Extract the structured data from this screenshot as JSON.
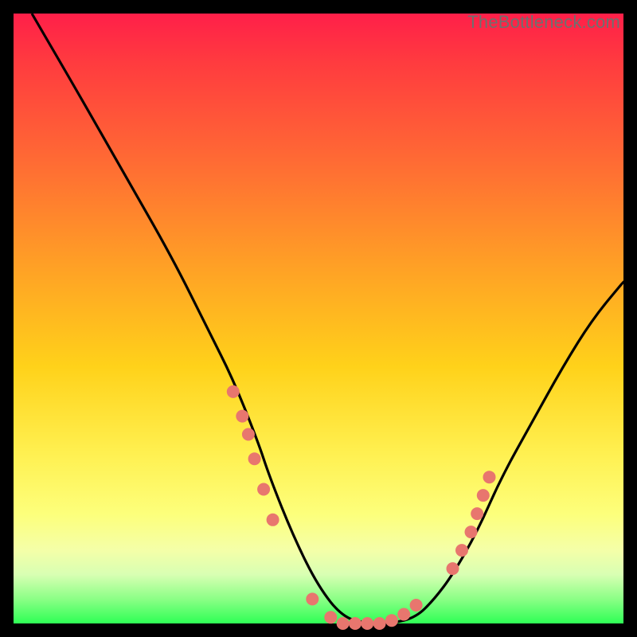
{
  "watermark": "TheBottleneck.com",
  "colors": {
    "page_bg": "#000000",
    "gradient_top": "#ff1f49",
    "gradient_mid": "#ffd21a",
    "gradient_bottom": "#2eff55",
    "curve": "#000000",
    "dots": "#e8766e"
  },
  "chart_data": {
    "type": "line",
    "title": "",
    "xlabel": "",
    "ylabel": "",
    "xlim": [
      0,
      100
    ],
    "ylim": [
      0,
      100
    ],
    "grid": false,
    "legend": false,
    "series": [
      {
        "name": "curve",
        "x": [
          3,
          10,
          18,
          26,
          32,
          36,
          40,
          42,
          46,
          50,
          54,
          58,
          62,
          66,
          69,
          72,
          76,
          80,
          85,
          90,
          95,
          100
        ],
        "values": [
          100,
          88,
          74,
          60,
          48,
          40,
          30,
          24,
          14,
          6,
          1,
          0,
          0,
          1,
          4,
          8,
          15,
          24,
          33,
          42,
          50,
          56
        ]
      }
    ],
    "dot_clusters": [
      {
        "name": "left-descent-dots",
        "x": [
          36,
          37.5,
          38.5,
          39.5,
          41,
          42.5
        ],
        "values": [
          38,
          34,
          31,
          27,
          22,
          17
        ]
      },
      {
        "name": "trough-dots",
        "x": [
          49,
          52,
          54,
          56,
          58,
          60,
          62,
          64,
          66
        ],
        "values": [
          4,
          1,
          0,
          0,
          0,
          0,
          0.5,
          1.5,
          3
        ]
      },
      {
        "name": "right-ascent-dots",
        "x": [
          72,
          73.5,
          75,
          76,
          77,
          78
        ],
        "values": [
          9,
          12,
          15,
          18,
          21,
          24
        ]
      }
    ]
  }
}
